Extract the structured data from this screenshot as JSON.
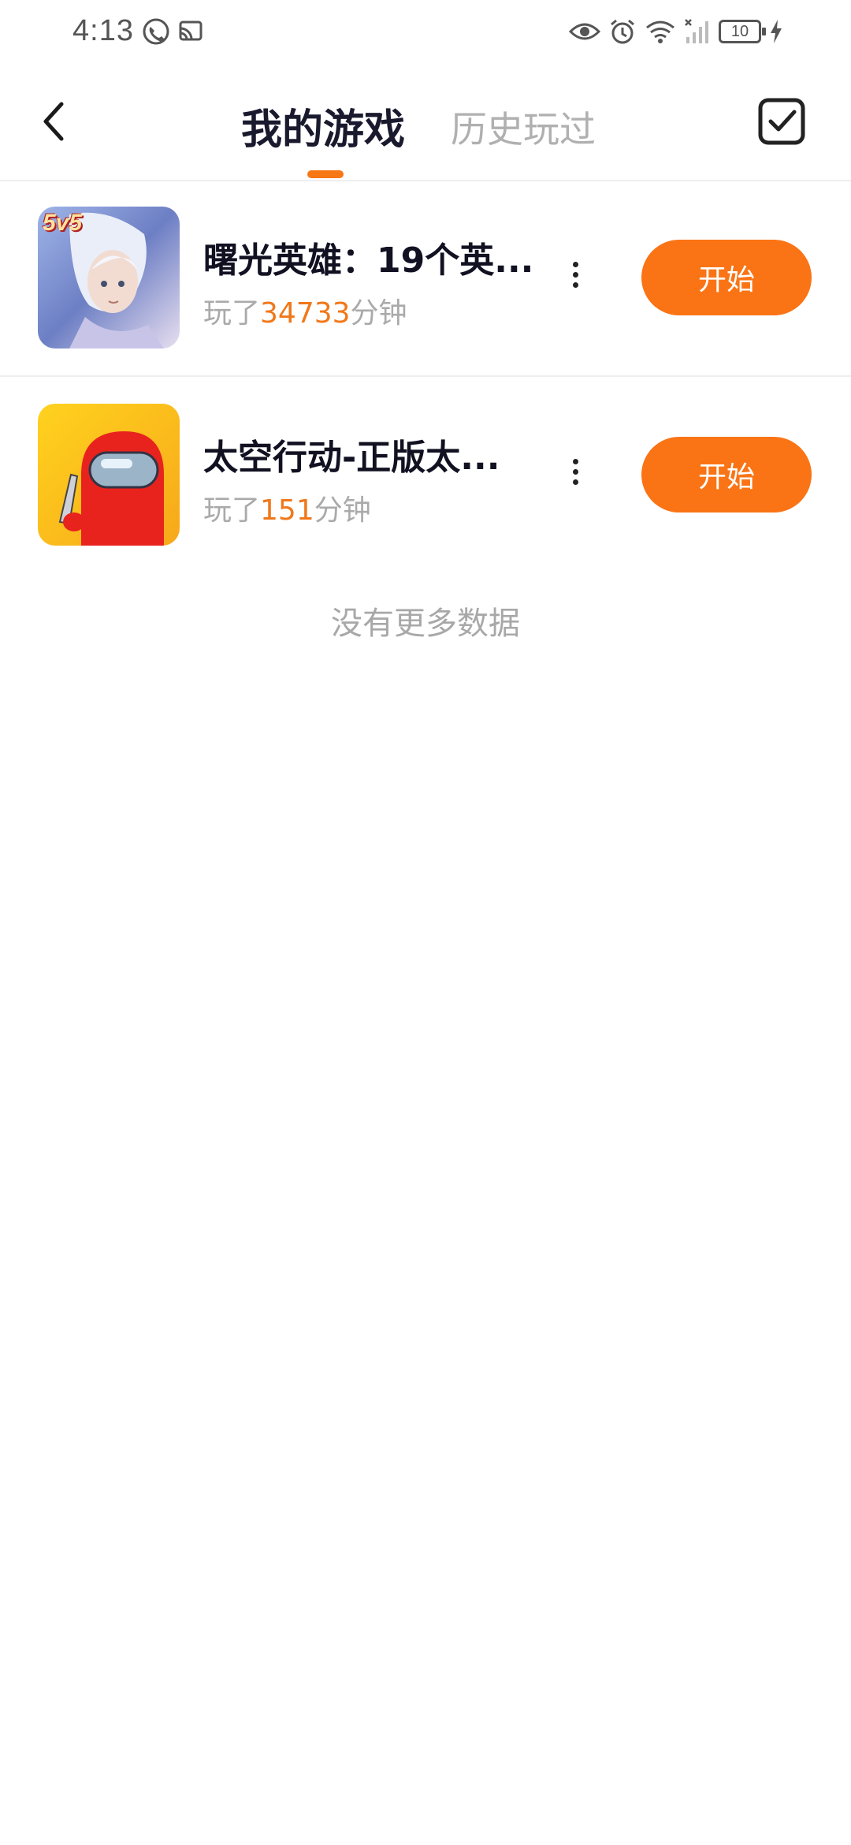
{
  "status_bar": {
    "time": "4:13",
    "battery_level": "10",
    "icons_left": [
      "hd-call-icon",
      "cast-icon"
    ],
    "icons_right": [
      "eye-icon",
      "alarm-icon",
      "wifi-icon",
      "signal-icon",
      "battery-icon",
      "charging-icon"
    ]
  },
  "header": {
    "tabs": [
      {
        "label": "我的游戏",
        "active": true
      },
      {
        "label": "历史玩过",
        "active": false
      }
    ],
    "back_icon": "chevron-left-icon",
    "select_icon": "checkbox-icon",
    "accent_color": "#f77715"
  },
  "games": [
    {
      "title": "曙光英雄：19个英...",
      "played_prefix": "玩了",
      "played_minutes": "34733",
      "played_suffix": "分钟",
      "start_label": "开始",
      "badge": "5v5"
    },
    {
      "title": "太空行动-正版太...",
      "played_prefix": "玩了",
      "played_minutes": "151",
      "played_suffix": "分钟",
      "start_label": "开始"
    }
  ],
  "footer": {
    "no_more_text": "没有更多数据"
  }
}
